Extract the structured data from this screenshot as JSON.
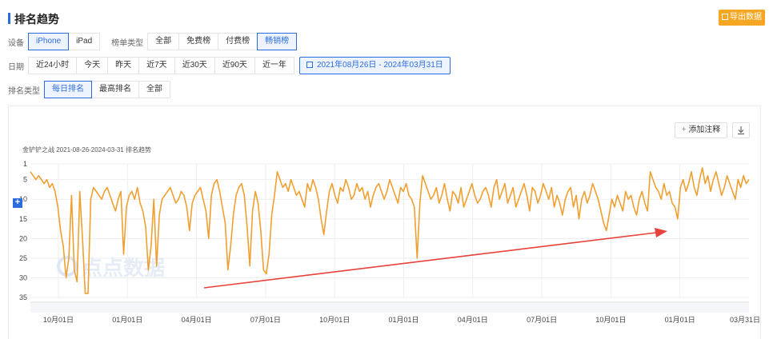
{
  "header": {
    "title": "排名趋势",
    "export_label": "导出数据",
    "export_icon": "export-icon"
  },
  "filters": {
    "device": {
      "label": "设备",
      "options": [
        "iPhone",
        "iPad"
      ],
      "selected": "iPhone"
    },
    "chart_type": {
      "label": "榜单类型",
      "options": [
        "全部",
        "免费榜",
        "付费榜",
        "畅销榜"
      ],
      "selected": "畅销榜"
    },
    "date": {
      "label": "日期",
      "options": [
        "近24小时",
        "今天",
        "昨天",
        "近7天",
        "近30天",
        "近90天",
        "近一年"
      ],
      "range": "2021年08月26日  -  2024年03月31日",
      "range_icon": "calendar-icon"
    },
    "rank_type": {
      "label": "排名类型",
      "options": [
        "每日排名",
        "最高排名",
        "全部"
      ],
      "selected": "每日排名"
    }
  },
  "toolbar": {
    "annotate_label": "添加注释",
    "annotate_icon": "plus-icon",
    "download_icon": "download-icon"
  },
  "watermark": "点点数据",
  "colors": {
    "accent": "#2d6cdf",
    "line": "#f0a030",
    "arrow": "#e8413a",
    "export": "#f5a623"
  },
  "chart_data": {
    "type": "line",
    "title": "金铲铲之战 2021-08-26-2024-03-31 排名趋势",
    "y_ticks": [
      1,
      5,
      10,
      15,
      20,
      25,
      30,
      35
    ],
    "ylim": [
      1,
      35
    ],
    "y_inverted": true,
    "x_ticks": [
      "10月01日",
      "01月01日",
      "04月01日",
      "07月01日",
      "10月01日",
      "01月01日",
      "04月01日",
      "07月01日",
      "10月01日",
      "01月01日",
      "03月31日"
    ],
    "grid": true,
    "series": [
      {
        "values": [
          3,
          4,
          5,
          4,
          5,
          6,
          5,
          7,
          6,
          8,
          12,
          18,
          22,
          30,
          25,
          9,
          28,
          31,
          8,
          20,
          34,
          34,
          10,
          7,
          8,
          9,
          10,
          8,
          7,
          9,
          11,
          13,
          10,
          8,
          24,
          12,
          9,
          8,
          10,
          7,
          11,
          13,
          17,
          28,
          22,
          10,
          27,
          14,
          10,
          9,
          8,
          7,
          9,
          11,
          10,
          8,
          9,
          12,
          18,
          11,
          9,
          8,
          7,
          10,
          13,
          20,
          9,
          6,
          5,
          8,
          12,
          16,
          28,
          22,
          14,
          9,
          7,
          6,
          9,
          17,
          27,
          13,
          8,
          11,
          18,
          28,
          29,
          24,
          14,
          9,
          3,
          5,
          7,
          6,
          8,
          5,
          7,
          9,
          8,
          10,
          12,
          6,
          8,
          5,
          7,
          10,
          15,
          19,
          13,
          8,
          6,
          9,
          11,
          7,
          8,
          5,
          7,
          10,
          9,
          6,
          8,
          7,
          10,
          8,
          12,
          9,
          7,
          6,
          8,
          10,
          8,
          5,
          7,
          9,
          11,
          7,
          8,
          6,
          9,
          10,
          12,
          25,
          11,
          4,
          6,
          8,
          10,
          9,
          7,
          11,
          9,
          6,
          10,
          13,
          8,
          9,
          11,
          7,
          12,
          10,
          8,
          6,
          9,
          11,
          10,
          8,
          7,
          9,
          12,
          7,
          5,
          10,
          8,
          6,
          11,
          9,
          7,
          12,
          10,
          8,
          6,
          9,
          13,
          7,
          8,
          11,
          9,
          6,
          8,
          10,
          7,
          12,
          9,
          11,
          14,
          10,
          8,
          7,
          12,
          9,
          15,
          10,
          8,
          11,
          9,
          6,
          8,
          10,
          13,
          16,
          18,
          14,
          10,
          12,
          9,
          11,
          13,
          8,
          10,
          9,
          12,
          14,
          10,
          8,
          11,
          13,
          3,
          5,
          7,
          8,
          10,
          6,
          9,
          8,
          11,
          12,
          15,
          7,
          5,
          8,
          6,
          3,
          7,
          9,
          5,
          2,
          6,
          4,
          8,
          5,
          3,
          6,
          9,
          7,
          4,
          6,
          8,
          10,
          5,
          7,
          4,
          6,
          5
        ]
      }
    ]
  }
}
